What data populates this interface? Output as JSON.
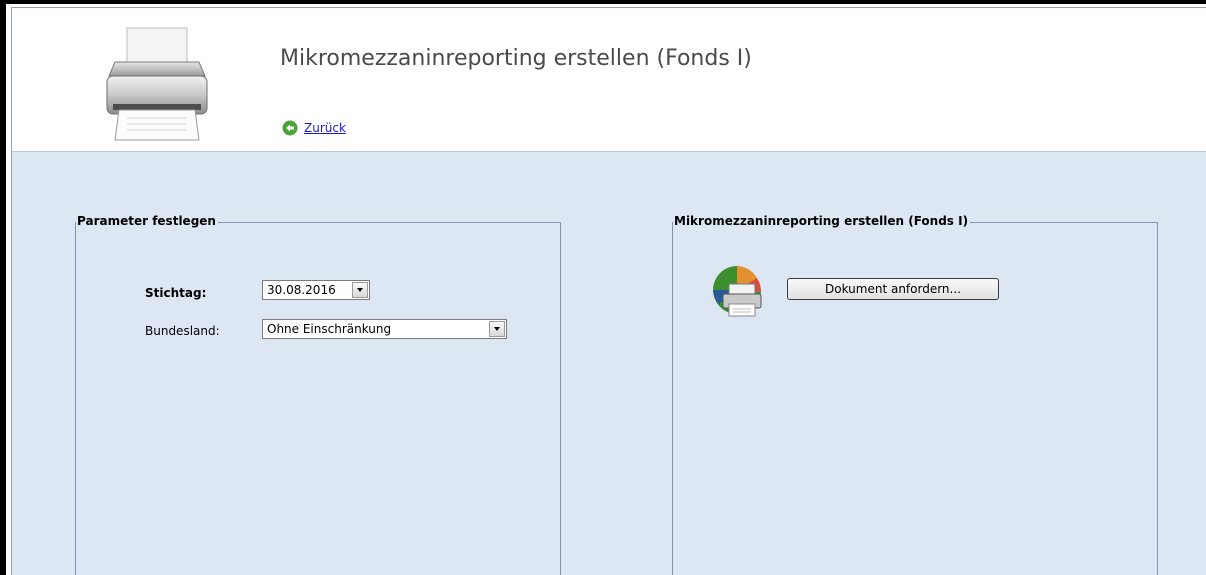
{
  "header": {
    "title": "Mikromezzaninreporting erstellen (Fonds I)",
    "back_label": "Zurück",
    "page_icon": "printer-icon",
    "back_icon": "back-arrow-icon"
  },
  "parameters": {
    "legend": "Parameter festlegen",
    "stichtag": {
      "label": "Stichtag:",
      "value": "30.08.2016"
    },
    "bundesland": {
      "label": "Bundesland:",
      "value": "Ohne Einschränkung"
    }
  },
  "report": {
    "legend": "Mikromezzaninreporting erstellen (Fonds I)",
    "icon": "report-print-icon",
    "button_label": "Dokument anfordern..."
  },
  "colors": {
    "background": "#dde7f4",
    "border": "#8295b5",
    "link": "#1a1ad6",
    "back_icon_green": "#4aa43a"
  }
}
